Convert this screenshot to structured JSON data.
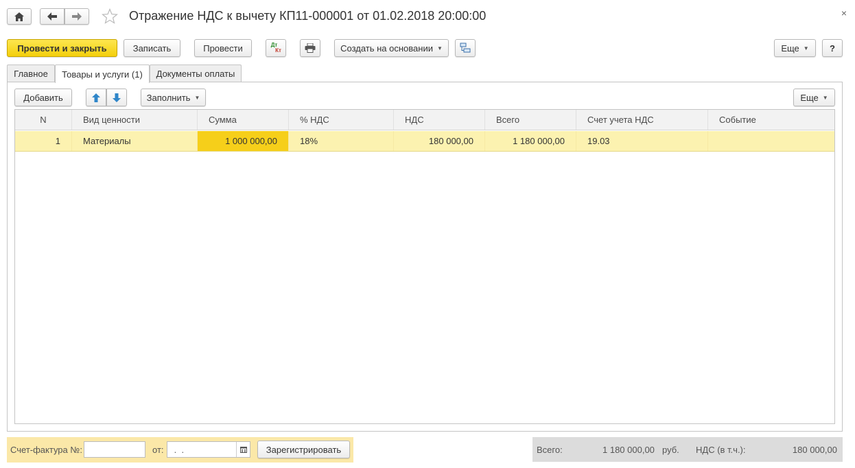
{
  "header": {
    "title": "Отражение НДС к вычету КП11-000001 от 01.02.2018 20:00:00",
    "close_glyph": "×"
  },
  "toolbar": {
    "post_close_label": "Провести и закрыть",
    "save_label": "Записать",
    "post_label": "Провести",
    "dtkt_top": "Дт",
    "dtkt_bottom": "Кт",
    "create_based_label": "Создать на основании",
    "more_label": "Еще",
    "help_label": "?"
  },
  "tabs": [
    {
      "label": "Главное",
      "active": false
    },
    {
      "label": "Товары и услуги (1)",
      "active": true
    },
    {
      "label": "Документы оплаты",
      "active": false
    }
  ],
  "table_toolbar": {
    "add_label": "Добавить",
    "fill_label": "Заполнить",
    "more_label": "Еще"
  },
  "table": {
    "columns": [
      "N",
      "Вид ценности",
      "Сумма",
      "% НДС",
      "НДС",
      "Всего",
      "Счет учета НДС",
      "Событие"
    ],
    "rows": [
      {
        "n": "1",
        "type": "Материалы",
        "sum": "1 000 000,00",
        "vat_rate": "18%",
        "vat": "180 000,00",
        "total": "1 180 000,00",
        "vat_account": "19.03",
        "event": ""
      }
    ]
  },
  "footer": {
    "invoice_label": "Счет-фактура №:",
    "invoice_value": "",
    "from_label": "от:",
    "date_value": " .  .",
    "register_label": "Зарегистрировать",
    "total_label": "Всего:",
    "total_value": "1 180 000,00",
    "currency": "руб.",
    "vat_label": "НДС (в т.ч.):",
    "vat_value": "180 000,00"
  },
  "colors": {
    "accent_yellow": "#f4cf0c",
    "row_highlight": "#fcf2b0",
    "selected_cell": "#f6cf1a",
    "invoice_panel": "#fbe8a8"
  }
}
